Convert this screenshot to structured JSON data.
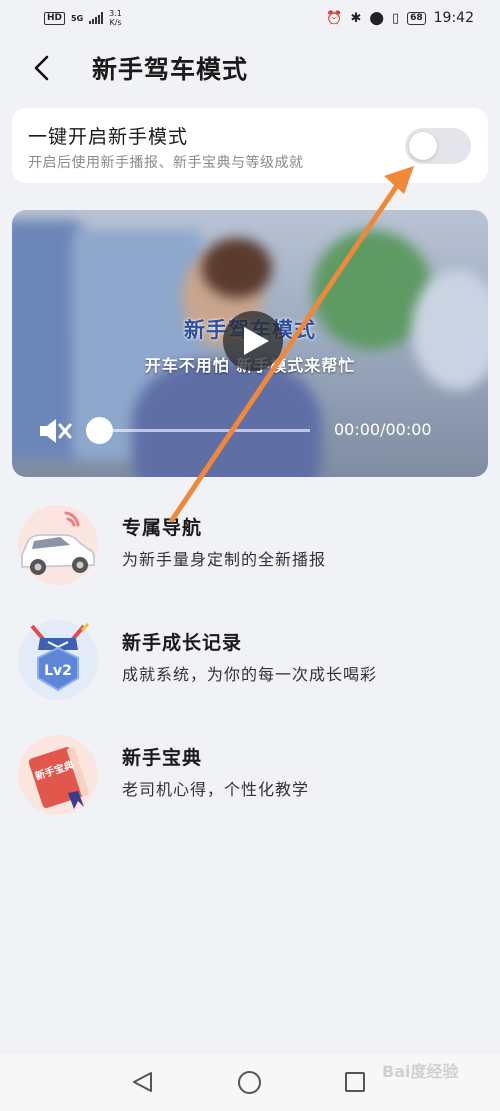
{
  "status_bar": {
    "hd": "HD",
    "network": "5G",
    "speed_value": "3.1",
    "speed_unit": "K/s",
    "battery": "68",
    "time": "19:42"
  },
  "header": {
    "title": "新手驾车模式"
  },
  "toggle_card": {
    "title": "一键开启新手模式",
    "subtitle": "开启后使用新手播报、新手宝典与等级成就",
    "enabled": false
  },
  "video": {
    "caption_title": "新手驾车模式",
    "caption_sub": "开车不用怕 新手模式来帮忙",
    "time": "00:00/00:00",
    "progress": 0
  },
  "features": [
    {
      "title": "专属导航",
      "desc": "为新手量身定制的全新播报",
      "icon": "car-icon"
    },
    {
      "title": "新手成长记录",
      "desc": "成就系统，为你的每一次成长喝彩",
      "icon": "lv2-badge-icon"
    },
    {
      "title": "新手宝典",
      "desc": "老司机心得，个性化教学",
      "icon": "book-icon"
    }
  ],
  "icon_texts": {
    "badge": "Lv2",
    "book": "新手宝典"
  },
  "watermark": "Bai度经验",
  "colors": {
    "arrow": "#f0883a",
    "background": "#f1f2f6",
    "switch_off": "#e4e5ea"
  }
}
